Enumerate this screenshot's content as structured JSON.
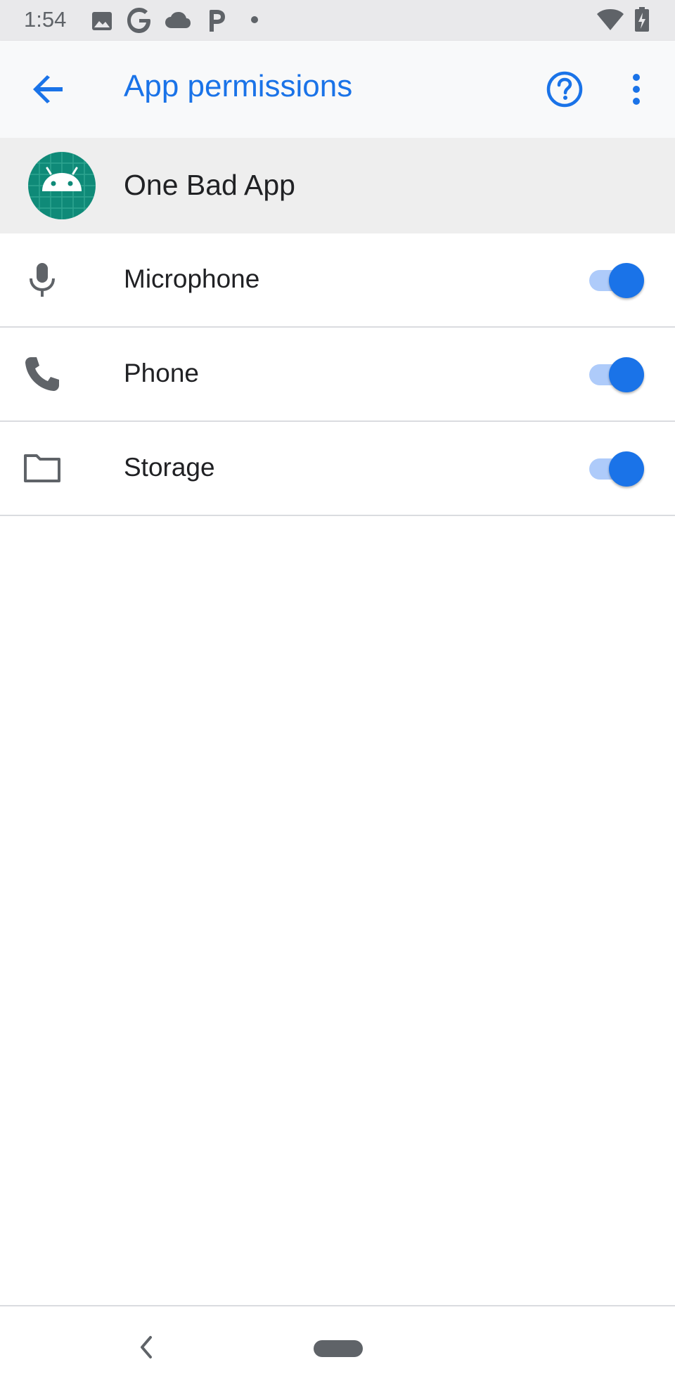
{
  "status_bar": {
    "time": "1:54",
    "icons": [
      "image-icon",
      "google-g-icon",
      "cloud-icon",
      "p-app-icon",
      "dot-icon",
      "wifi-icon",
      "battery-charging-icon"
    ]
  },
  "app_bar": {
    "title": "App permissions",
    "back_icon": "arrow-left-icon",
    "help_icon": "help-circle-icon",
    "more_icon": "more-vert-icon",
    "accent_color": "#1a73e8"
  },
  "app_header": {
    "name": "One Bad App",
    "icon": "android-icon",
    "icon_color": "#0f8a78"
  },
  "permissions": [
    {
      "label": "Microphone",
      "icon": "microphone-icon",
      "enabled": true
    },
    {
      "label": "Phone",
      "icon": "phone-icon",
      "enabled": true
    },
    {
      "label": "Storage",
      "icon": "folder-icon",
      "enabled": true
    }
  ],
  "nav_bar": {
    "back_icon": "nav-back-icon",
    "home_icon": "home-pill-icon"
  }
}
